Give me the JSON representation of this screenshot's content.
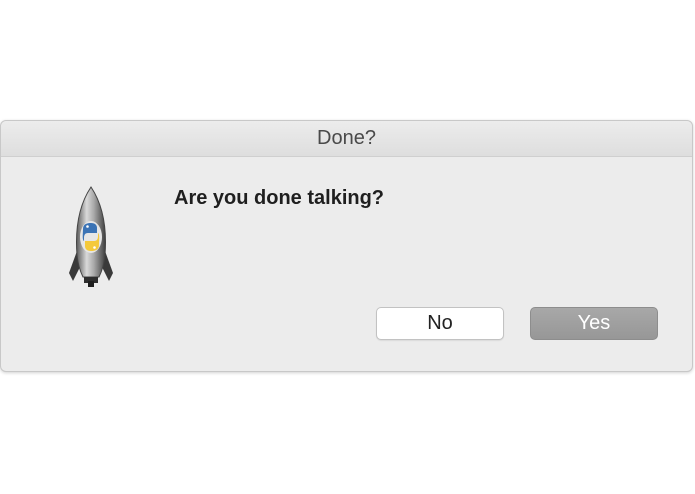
{
  "window": {
    "title": "Done?"
  },
  "dialog": {
    "message": "Are you done talking?",
    "icon": "python-launcher-rocket-icon"
  },
  "buttons": {
    "no_label": "No",
    "yes_label": "Yes"
  },
  "colors": {
    "dialog_bg": "#ececec",
    "default_button": "#9e9e9e",
    "secondary_button": "#ffffff"
  }
}
